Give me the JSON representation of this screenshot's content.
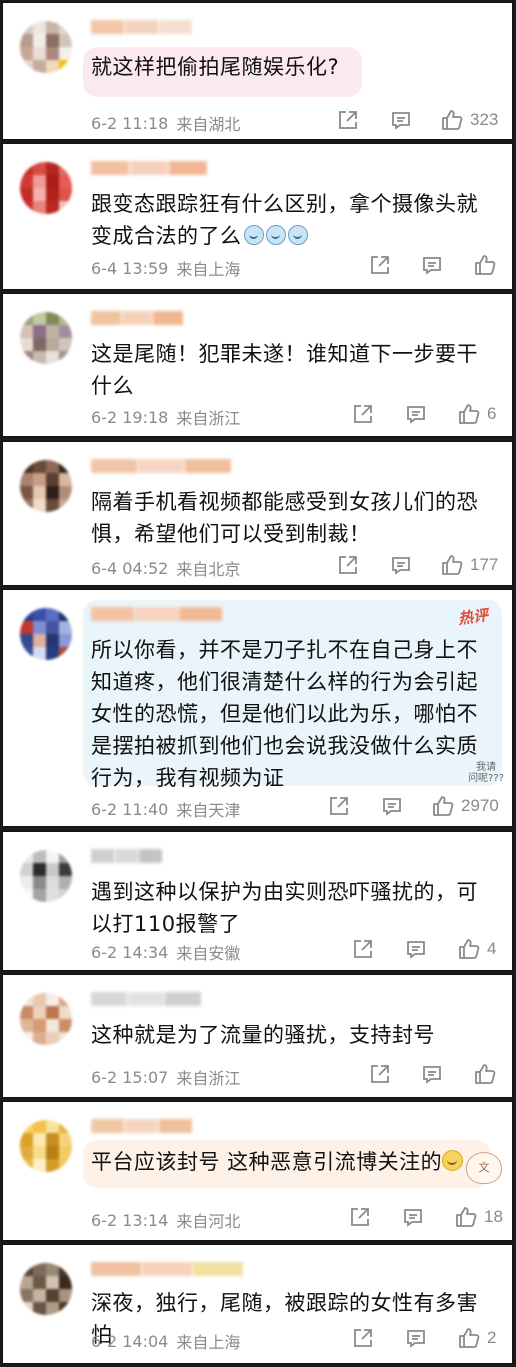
{
  "comments": [
    {
      "text": "就这样把偷拍尾随娱乐化?",
      "time": "6-2 11:18",
      "location": "来自湖北",
      "likes": "323",
      "avatar": [
        "#d8c9c2",
        "#efe4de",
        "#c9b4a8",
        "#e2d6cf",
        "#b79c8e",
        "#f2ece8",
        "#8d6e62",
        "#d4c3b8",
        "#c7a898",
        "#e9ddd6",
        "#a88a7c",
        "#f6efe9",
        "#e8d2c4",
        "#c4ad9f",
        "#f0d8b8",
        "#f1c40f"
      ],
      "name_colors": [
        "#f3c7a8",
        "#f1d3bf",
        "#f6dfcf"
      ],
      "bubble": "#fbe9ef"
    },
    {
      "text": "跟变态跟踪狂有什么区别，拿个摄像头就变成合法的了么",
      "emoji_count": 3,
      "time": "6-4 13:59",
      "location": "来自上海",
      "likes": "",
      "avatar": [
        "#c9302c",
        "#d94a44",
        "#b62520",
        "#e06b66",
        "#d43a35",
        "#ee9b96",
        "#a91d18",
        "#e55c56",
        "#c22b26",
        "#f2b3ae",
        "#b0211c",
        "#de534d",
        "#cc3530",
        "#e8827d",
        "#bd2823",
        "#f4c1bd"
      ],
      "name_colors": [
        "#f4c0a2",
        "#f6d2bc",
        "#f2b896"
      ],
      "bubble": ""
    },
    {
      "text": "这是尾随！犯罪未遂！谁知道下一步要干什么",
      "time": "6-2 19:18",
      "location": "来自浙江",
      "likes": "6",
      "avatar": [
        "#9aa37a",
        "#c4c8a4",
        "#7f8a5c",
        "#b2b891",
        "#d6c1b4",
        "#8c6f86",
        "#c2b2a0",
        "#a08f9f",
        "#e6dcd4",
        "#7c6a62",
        "#b9aa9c",
        "#d1c5bb",
        "#9c8b7f",
        "#cbb9ad",
        "#e9e1da",
        "#a69387"
      ],
      "name_colors": [
        "#f0c39d",
        "#f5d1b8",
        "#efb78f"
      ],
      "bubble": ""
    },
    {
      "text": "隔着手机看视频都能感受到女孩儿们的恐惧，希望他们可以受到制裁！",
      "time": "6-4 04:52",
      "location": "来自北京",
      "likes": "177",
      "avatar": [
        "#4a3228",
        "#6b4a3a",
        "#8c6a58",
        "#3a261e",
        "#a8836e",
        "#c49e86",
        "#5c3e30",
        "#d9b8a1",
        "#7a5646",
        "#e4c8b2",
        "#2e1e17",
        "#b48d77",
        "#9a7460",
        "#f0dccb",
        "#6a4a3b",
        "#c8a690"
      ],
      "name_colors": [
        "#f1c6a8",
        "#f5d6c2",
        "#f0bf9c"
      ],
      "bubble": ""
    },
    {
      "text": "所以你看，并不是刀子扎不在自己身上不知道疼，他们很清楚什么样的行为会引起女性的恐慌，但是他们以此为乐，哪怕不是摆拍被抓到他们也会说我没做什么实质行为，我有视频为证",
      "time": "6-2 11:40",
      "location": "来自天津",
      "likes": "2970",
      "hot": "热评",
      "note": "我请\n问呢???",
      "avatar": [
        "#2c3e8c",
        "#3a4fa8",
        "#5a6fc2",
        "#1f2d6e",
        "#c0392b",
        "#7d8fd6",
        "#4254a0",
        "#a6b2e2",
        "#34498f",
        "#e0b0a0",
        "#26356f",
        "#8a99d8",
        "#3c4f9a",
        "#d5dbf1",
        "#2a3b80",
        "#b24a3a"
      ],
      "name_colors": [
        "#f2c4a4",
        "#f6d4bd",
        "#f0ba95"
      ],
      "bubble": "#e9f4fb"
    },
    {
      "text": "遇到这种以保护为由实则恐吓骚扰的，可以打110报警了",
      "time": "6-2 14:34",
      "location": "来自安徽",
      "likes": "4",
      "avatar": [
        "#e8e8e8",
        "#bdbdbd",
        "#f4f4f4",
        "#9e9e9e",
        "#d0d0d0",
        "#2b2b2b",
        "#c8c8c8",
        "#3b3b3b",
        "#ededed",
        "#8a8a8a",
        "#dcdcdc",
        "#b0b0b0",
        "#f7f7f7",
        "#a4a4a4",
        "#e0e0e0",
        "#cfcfcf"
      ],
      "name_colors": [
        "#cfcfcf",
        "#dadada",
        "#c4c4c4"
      ],
      "bubble": ""
    },
    {
      "text": "这种就是为了流量的骚扰，支持封号",
      "time": "6-2 15:07",
      "location": "来自浙江",
      "likes": "",
      "avatar": [
        "#f2e3d6",
        "#e8c7ad",
        "#f7ede4",
        "#d9a98a",
        "#c88a64",
        "#ecd0ba",
        "#b8774f",
        "#f0dccb",
        "#e2b597",
        "#d69a74",
        "#f5e6da",
        "#c98d66",
        "#f8f0e8",
        "#dcae8f",
        "#ead0bc",
        "#f3e4d8"
      ],
      "name_colors": [
        "#d8d8d8",
        "#e2e2e2",
        "#cfcfcf"
      ],
      "bubble": ""
    },
    {
      "text": "平台应该封号 这种恶意引流博关注的",
      "smile": true,
      "time": "6-2 13:14",
      "location": "来自河北",
      "likes": "18",
      "avatar": [
        "#f6d365",
        "#f2c14e",
        "#f9e29a",
        "#e8b23a",
        "#d9a12a",
        "#fbe9b1",
        "#c48f1e",
        "#f5d27a",
        "#e0ad3a",
        "#f7dc8c",
        "#b97f14",
        "#f3cc62",
        "#eab947",
        "#fcefc4",
        "#d49a26",
        "#f1c85a"
      ],
      "name_colors": [
        "#f1c8a6",
        "#f5d5c0",
        "#eec09c"
      ],
      "bubble": "#fdf1e8",
      "sticker": "文"
    },
    {
      "text": "深夜，独行，尾随，被跟踪的女性有多害怕",
      "time": "6-2 14:04",
      "location": "来自上海",
      "likes": "2",
      "avatar": [
        "#5b4636",
        "#7d6a5a",
        "#9a8776",
        "#463426",
        "#b7a594",
        "#6d5847",
        "#d2c2b3",
        "#3a2a1e",
        "#8a7563",
        "#c5b3a2",
        "#54402f",
        "#a8937f",
        "#e1d4c7",
        "#6a5444",
        "#b09c89",
        "#4d392a"
      ],
      "name_colors": [
        "#f0c19f",
        "#f5d2ba",
        "#f2e0a0"
      ],
      "bubble": ""
    }
  ]
}
